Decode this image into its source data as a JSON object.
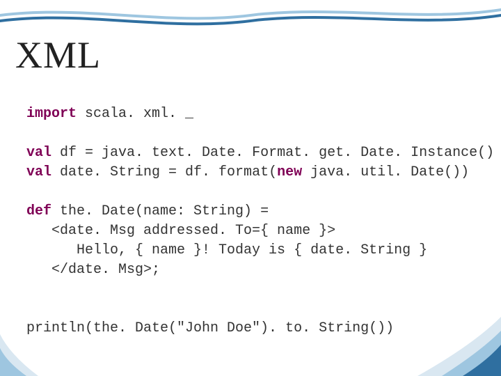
{
  "title": "XML",
  "code": {
    "l1_kw": "import",
    "l1_rest": " scala. xml. _",
    "l3_kw1": "val",
    "l3_mid": " df = java. text. Date. Format. get. Date. Instance()",
    "l4_kw1": "val",
    "l4_mid": " date. String = df. format(",
    "l4_kw2": "new",
    "l4_rest": " java. util. Date())",
    "l6_kw": "def",
    "l6_rest": " the. Date(name: String) =",
    "l7": "   <date. Msg addressed. To={ name }>",
    "l8": "      Hello, { name }! Today is { date. String }",
    "l9": "   </date. Msg>;",
    "l11": "println(the. Date(\"John Doe\"). to. String())"
  }
}
